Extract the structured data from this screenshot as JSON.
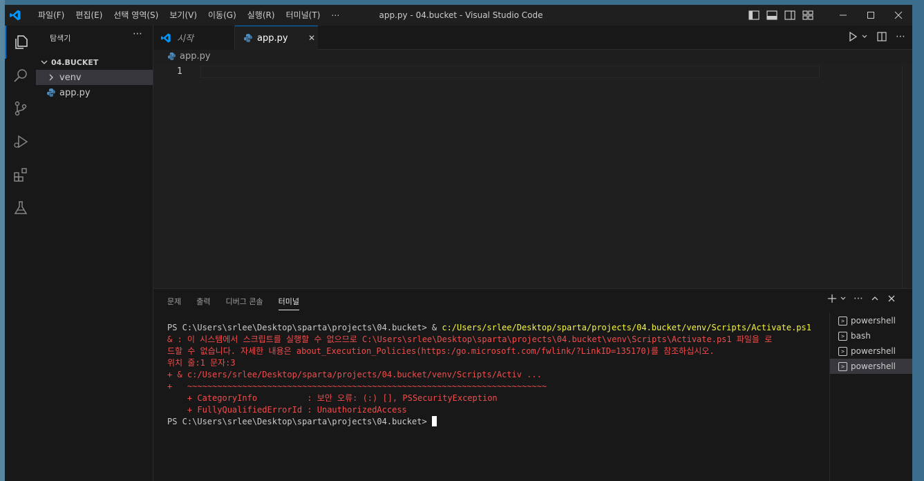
{
  "window": {
    "menu": [
      "파일(F)",
      "편집(E)",
      "선택 영역(S)",
      "보기(V)",
      "이동(G)",
      "실행(R)",
      "터미널(T)",
      "⋯"
    ],
    "title": "app.py - 04.bucket - Visual Studio Code"
  },
  "sidebar": {
    "title": "탐색기",
    "more": "⋯",
    "folder": "04.BUCKET",
    "items": [
      {
        "label": "venv",
        "icon": "chevron-right-icon"
      },
      {
        "label": "app.py",
        "icon": "python-icon"
      }
    ]
  },
  "tabs": [
    {
      "label": "시작",
      "icon": "vscode-icon"
    },
    {
      "label": "app.py",
      "icon": "python-icon",
      "close": "✕"
    }
  ],
  "editor": {
    "breadcrumb": "app.py",
    "line_number": "1"
  },
  "panel": {
    "tabs": [
      "문제",
      "출력",
      "디버그 콘솔",
      "터미널"
    ],
    "active_tab": "터미널",
    "terminal": {
      "line1_prompt": "PS C:\\Users\\srlee\\Desktop\\sparta\\projects\\04.bucket> & ",
      "line1_cmd": "c:/Users/srlee/Desktop/sparta/projects/04.bucket/venv/Scripts/Activate.ps1",
      "errors": [
        "& : 이 시스템에서 스크립트를 실행할 수 없으므로 C:\\Users\\srlee\\Desktop\\sparta\\projects\\04.bucket\\venv\\Scripts\\Activate.ps1 파일을 로",
        "드할 수 없습니다. 자세한 내용은 about_Execution_Policies(https:/go.microsoft.com/fwlink/?LinkID=135170)를 참조하십시오.",
        "위치 줄:1 문자:3",
        "+ & c:/Users/srlee/Desktop/sparta/projects/04.bucket/venv/Scripts/Activ ...",
        "+   ~~~~~~~~~~~~~~~~~~~~~~~~~~~~~~~~~~~~~~~~~~~~~~~~~~~~~~~~~~~~~~~~~~~~~~~~",
        "    + CategoryInfo          : 보안 오류: (:) [], PSSecurityException",
        "    + FullyQualifiedErrorId : UnauthorizedAccess"
      ],
      "last_prompt": "PS C:\\Users\\srlee\\Desktop\\sparta\\projects\\04.bucket> "
    },
    "terminals": [
      {
        "label": "powershell",
        "selected": false
      },
      {
        "label": "bash",
        "selected": false
      },
      {
        "label": "powershell",
        "selected": false
      },
      {
        "label": "powershell",
        "selected": true
      }
    ]
  },
  "colors": {
    "accent": "#0078d4",
    "error": "#f14c4c",
    "command": "#f5f543"
  }
}
